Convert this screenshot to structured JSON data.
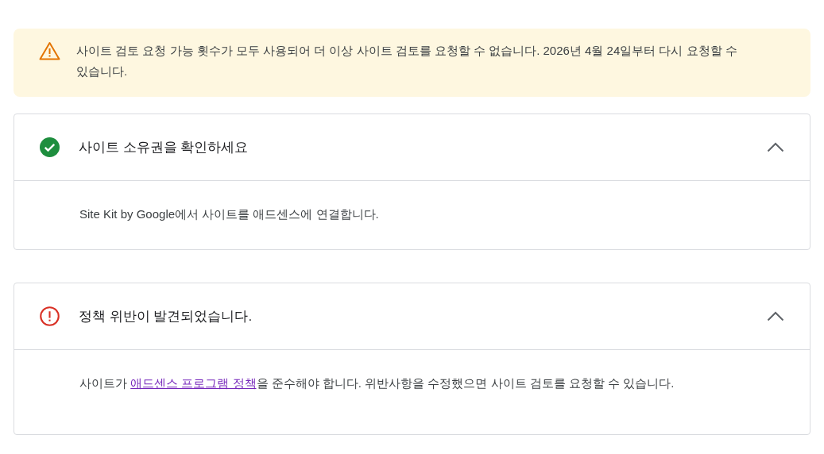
{
  "notice": {
    "kind": "warning",
    "text": "사이트 검토 요청 가능 횟수가 모두 사용되어 더 이상 사이트 검토를 요청할 수 없습니다. 2026년 4월 24일부터 다시 요청할 수 있습니다."
  },
  "sections": [
    {
      "kind": "success",
      "title": "사이트 소유권을 확인하세요",
      "expanded": true,
      "body": {
        "before": "Site Kit by Google에서 사이트를 애드센스에 연결합니다."
      }
    },
    {
      "kind": "error",
      "title": "정책 위반이 발견되었습니다.",
      "expanded": true,
      "body": {
        "before": "사이트가 ",
        "link": "애드센스 프로그램 정책",
        "after": "을 준수해야 합니다. 위반사항을 수정했으면 사이트 검토를 요청할 수 있습니다."
      }
    }
  ]
}
